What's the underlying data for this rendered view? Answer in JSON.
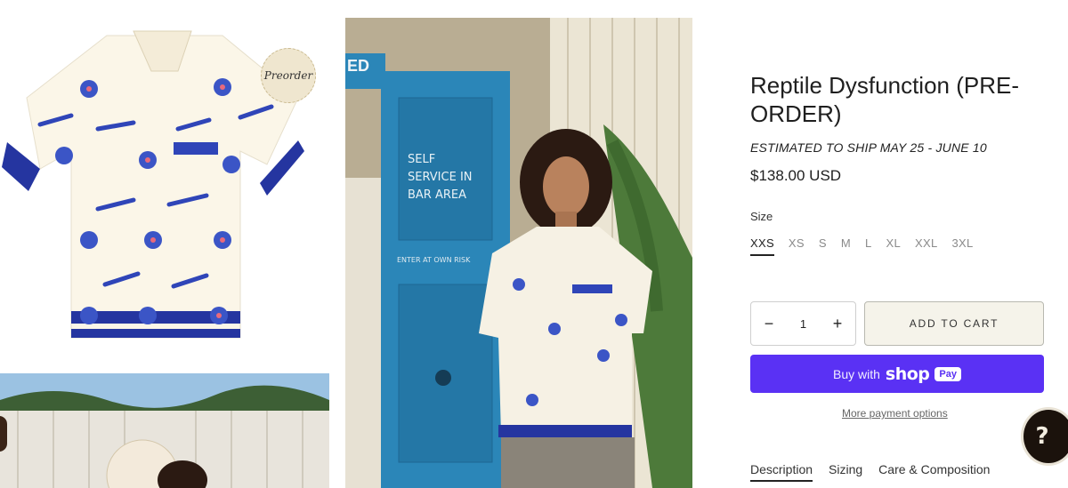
{
  "gallery": {
    "preorder_badge": "Preorder",
    "door_sign_text": "SELF SERVICE IN BAR AREA",
    "door_small_text": "ENTER AT OWN RISK",
    "top_sign": "ED"
  },
  "product": {
    "title": "Reptile Dysfunction (PRE-ORDER)",
    "ship_note": "ESTIMATED TO SHIP MAY 25 - JUNE 10",
    "price": "$138.00 USD"
  },
  "size": {
    "label": "Size",
    "options": [
      "XXS",
      "XS",
      "S",
      "M",
      "L",
      "XL",
      "XXL",
      "3XL"
    ],
    "selected": "XXS"
  },
  "quantity": {
    "minus": "−",
    "value": "1",
    "plus": "+"
  },
  "buttons": {
    "add_to_cart": "ADD TO CART",
    "buy_with": "Buy with",
    "shop": "shop",
    "pay": "Pay",
    "more_payment": "More payment options"
  },
  "tabs": [
    "Description",
    "Sizing",
    "Care & Composition"
  ],
  "help": {
    "glyph": "?"
  },
  "colors": {
    "shop_pay": "#5a31f4",
    "shirt_print": "#2f45b8",
    "door_blue": "#2b86b8"
  }
}
